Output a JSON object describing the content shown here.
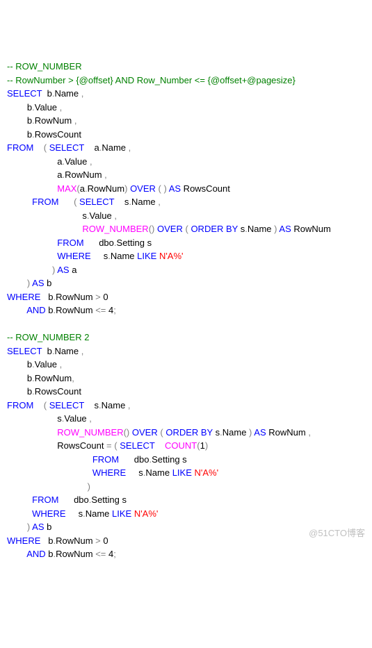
{
  "watermark": "@51CTO博客",
  "tokens": [
    {
      "c": "cm",
      "t": "-- ROW_NUMBER"
    },
    "\n",
    {
      "c": "cm",
      "t": "-- RowNumber > {@offset} AND Row_Number <= {@offset+@pagesize}"
    },
    "\n",
    {
      "c": "kw",
      "t": "SELECT"
    },
    "  b",
    {
      "c": "gy",
      "t": "."
    },
    "Name ",
    {
      "c": "gy",
      "t": ","
    },
    "\n",
    "        b",
    {
      "c": "gy",
      "t": "."
    },
    "Value ",
    {
      "c": "gy",
      "t": ","
    },
    "\n",
    "        b",
    {
      "c": "gy",
      "t": "."
    },
    "RowNum ",
    {
      "c": "gy",
      "t": ","
    },
    "\n",
    "        b",
    {
      "c": "gy",
      "t": "."
    },
    "RowsCount",
    "\n",
    {
      "c": "kw",
      "t": "FROM"
    },
    "    ",
    {
      "c": "gy",
      "t": "("
    },
    " ",
    {
      "c": "kw",
      "t": "SELECT"
    },
    "    a",
    {
      "c": "gy",
      "t": "."
    },
    "Name ",
    {
      "c": "gy",
      "t": ","
    },
    "\n",
    "                    a",
    {
      "c": "gy",
      "t": "."
    },
    "Value ",
    {
      "c": "gy",
      "t": ","
    },
    "\n",
    "                    a",
    {
      "c": "gy",
      "t": "."
    },
    "RowNum ",
    {
      "c": "gy",
      "t": ","
    },
    "\n",
    "                    ",
    {
      "c": "fn",
      "t": "MAX"
    },
    {
      "c": "gy",
      "t": "("
    },
    "a",
    {
      "c": "gy",
      "t": "."
    },
    "RowNum",
    {
      "c": "gy",
      "t": ")"
    },
    " ",
    {
      "c": "kw",
      "t": "OVER"
    },
    " ",
    {
      "c": "gy",
      "t": "( )"
    },
    " ",
    {
      "c": "kw",
      "t": "AS"
    },
    " RowsCount",
    "\n",
    "          ",
    {
      "c": "kw",
      "t": "FROM"
    },
    "      ",
    {
      "c": "gy",
      "t": "("
    },
    " ",
    {
      "c": "kw",
      "t": "SELECT"
    },
    "    s",
    {
      "c": "gy",
      "t": "."
    },
    "Name ",
    {
      "c": "gy",
      "t": ","
    },
    "\n",
    "                              s",
    {
      "c": "gy",
      "t": "."
    },
    "Value ",
    {
      "c": "gy",
      "t": ","
    },
    "\n",
    "                              ",
    {
      "c": "fn",
      "t": "ROW_NUMBER"
    },
    {
      "c": "gy",
      "t": "()"
    },
    " ",
    {
      "c": "kw",
      "t": "OVER"
    },
    " ",
    {
      "c": "gy",
      "t": "("
    },
    " ",
    {
      "c": "kw",
      "t": "ORDER BY"
    },
    " s",
    {
      "c": "gy",
      "t": "."
    },
    "Name ",
    {
      "c": "gy",
      "t": ")"
    },
    " ",
    {
      "c": "kw",
      "t": "AS"
    },
    " RowNum",
    "\n",
    "                    ",
    {
      "c": "kw",
      "t": "FROM"
    },
    "      dbo",
    {
      "c": "gy",
      "t": "."
    },
    "Setting s",
    "\n",
    "                    ",
    {
      "c": "kw",
      "t": "WHERE"
    },
    "     s",
    {
      "c": "gy",
      "t": "."
    },
    "Name ",
    {
      "c": "kw",
      "t": "LIKE"
    },
    " ",
    {
      "c": "str",
      "t": "N'A%'"
    },
    "\n",
    "                  ",
    {
      "c": "gy",
      "t": ")"
    },
    " ",
    {
      "c": "kw",
      "t": "AS"
    },
    " a",
    "\n",
    "        ",
    {
      "c": "gy",
      "t": ")"
    },
    " ",
    {
      "c": "kw",
      "t": "AS"
    },
    " b",
    "\n",
    {
      "c": "kw",
      "t": "WHERE"
    },
    "   b",
    {
      "c": "gy",
      "t": "."
    },
    "RowNum ",
    {
      "c": "op",
      "t": ">"
    },
    " 0",
    "\n",
    "        ",
    {
      "c": "kw",
      "t": "AND"
    },
    " b",
    {
      "c": "gy",
      "t": "."
    },
    "RowNum ",
    {
      "c": "op",
      "t": "<="
    },
    " 4",
    {
      "c": "gy",
      "t": ";"
    },
    "\n",
    "\n",
    {
      "c": "cm",
      "t": "-- ROW_NUMBER 2"
    },
    "\n",
    {
      "c": "kw",
      "t": "SELECT"
    },
    "  b",
    {
      "c": "gy",
      "t": "."
    },
    "Name ",
    {
      "c": "gy",
      "t": ","
    },
    "\n",
    "        b",
    {
      "c": "gy",
      "t": "."
    },
    "Value ",
    {
      "c": "gy",
      "t": ","
    },
    "\n",
    "        b",
    {
      "c": "gy",
      "t": "."
    },
    "RowNum",
    {
      "c": "gy",
      "t": ","
    },
    "\n",
    "        b",
    {
      "c": "gy",
      "t": "."
    },
    "RowsCount",
    "\n",
    {
      "c": "kw",
      "t": "FROM"
    },
    "    ",
    {
      "c": "gy",
      "t": "("
    },
    " ",
    {
      "c": "kw",
      "t": "SELECT"
    },
    "    s",
    {
      "c": "gy",
      "t": "."
    },
    "Name ",
    {
      "c": "gy",
      "t": ","
    },
    "\n",
    "                    s",
    {
      "c": "gy",
      "t": "."
    },
    "Value ",
    {
      "c": "gy",
      "t": ","
    },
    "\n",
    "                    ",
    {
      "c": "fn",
      "t": "ROW_NUMBER"
    },
    {
      "c": "gy",
      "t": "()"
    },
    " ",
    {
      "c": "kw",
      "t": "OVER"
    },
    " ",
    {
      "c": "gy",
      "t": "("
    },
    " ",
    {
      "c": "kw",
      "t": "ORDER BY"
    },
    " s",
    {
      "c": "gy",
      "t": "."
    },
    "Name ",
    {
      "c": "gy",
      "t": ")"
    },
    " ",
    {
      "c": "kw",
      "t": "AS"
    },
    " RowNum ",
    {
      "c": "gy",
      "t": ","
    },
    "\n",
    "                    RowsCount ",
    {
      "c": "op",
      "t": "="
    },
    " ",
    {
      "c": "gy",
      "t": "("
    },
    " ",
    {
      "c": "kw",
      "t": "SELECT"
    },
    "    ",
    {
      "c": "fn",
      "t": "COUNT"
    },
    {
      "c": "gy",
      "t": "("
    },
    "1",
    {
      "c": "gy",
      "t": ")"
    },
    "\n",
    "                                  ",
    {
      "c": "kw",
      "t": "FROM"
    },
    "      dbo",
    {
      "c": "gy",
      "t": "."
    },
    "Setting s",
    "\n",
    "                                  ",
    {
      "c": "kw",
      "t": "WHERE"
    },
    "     s",
    {
      "c": "gy",
      "t": "."
    },
    "Name ",
    {
      "c": "kw",
      "t": "LIKE"
    },
    " ",
    {
      "c": "str",
      "t": "N'A%'"
    },
    "\n",
    "                                ",
    {
      "c": "gy",
      "t": ")"
    },
    "\n",
    "          ",
    {
      "c": "kw",
      "t": "FROM"
    },
    "      dbo",
    {
      "c": "gy",
      "t": "."
    },
    "Setting s",
    "\n",
    "          ",
    {
      "c": "kw",
      "t": "WHERE"
    },
    "     s",
    {
      "c": "gy",
      "t": "."
    },
    "Name ",
    {
      "c": "kw",
      "t": "LIKE"
    },
    " ",
    {
      "c": "str",
      "t": "N'A%'"
    },
    "\n",
    "        ",
    {
      "c": "gy",
      "t": ")"
    },
    " ",
    {
      "c": "kw",
      "t": "AS"
    },
    " b",
    "\n",
    {
      "c": "kw",
      "t": "WHERE"
    },
    "   b",
    {
      "c": "gy",
      "t": "."
    },
    "RowNum ",
    {
      "c": "op",
      "t": ">"
    },
    " 0",
    "\n",
    "        ",
    {
      "c": "kw",
      "t": "AND"
    },
    " b",
    {
      "c": "gy",
      "t": "."
    },
    "RowNum ",
    {
      "c": "op",
      "t": "<="
    },
    " 4",
    {
      "c": "gy",
      "t": ";"
    },
    "\n"
  ]
}
